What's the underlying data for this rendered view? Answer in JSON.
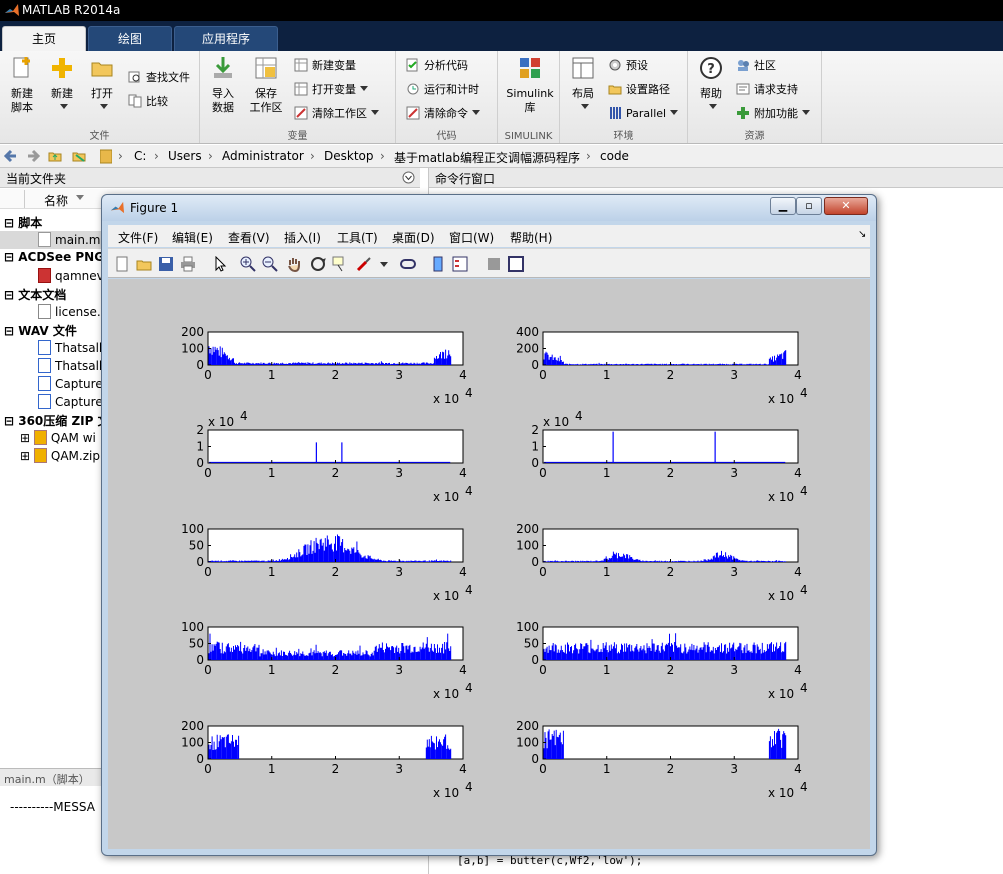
{
  "window": {
    "title": "MATLAB R2014a"
  },
  "tabs": [
    {
      "label": "主页",
      "active": true
    },
    {
      "label": "绘图",
      "active": false
    },
    {
      "label": "应用程序",
      "active": false
    }
  ],
  "ribbon": {
    "file": {
      "section_label": "文件",
      "new_script": "新建\n脚本",
      "new": "新建",
      "open": "打开",
      "find_files": "查找文件",
      "compare": "比较"
    },
    "variable": {
      "section_label": "变量",
      "import": "导入\n数据",
      "save_ws": "保存\n工作区",
      "new_var": "新建变量",
      "open_var": "打开变量",
      "clear_ws": "清除工作区"
    },
    "code": {
      "section_label": "代码",
      "analyze": "分析代码",
      "run_time": "运行和计时",
      "clear_cmd": "清除命令"
    },
    "simulink": {
      "section_label": "SIMULINK",
      "lib": "Simulink\n库"
    },
    "env": {
      "section_label": "环境",
      "layout": "布局",
      "prefs": "预设",
      "set_path": "设置路径",
      "parallel": "Parallel"
    },
    "resources": {
      "section_label": "资源",
      "help": "帮助",
      "community": "社区",
      "request_support": "请求支持",
      "addons": "附加功能"
    }
  },
  "address": {
    "crumbs": [
      "C:",
      "Users",
      "Administrator",
      "Desktop",
      "基于matlab编程正交调幅源码程序",
      "code"
    ]
  },
  "left_panel": {
    "title": "当前文件夹",
    "col_name": "名称",
    "groups": [
      {
        "label": "脚本",
        "items": [
          {
            "name": "main.m",
            "selected": true
          }
        ]
      },
      {
        "label": "ACDSee PNG",
        "items": [
          {
            "name": "qamnev"
          }
        ]
      },
      {
        "label": "文本文档",
        "items": [
          {
            "name": "license.t"
          }
        ]
      },
      {
        "label": "WAV 文件",
        "items": [
          {
            "name": "Thatsall"
          },
          {
            "name": "Thatsall"
          },
          {
            "name": "Capture"
          },
          {
            "name": "Capture"
          }
        ]
      },
      {
        "label": "360压缩 ZIP 文",
        "items": [
          {
            "name": "QAM wi"
          },
          {
            "name": "QAM.zip"
          }
        ]
      }
    ],
    "details_label": "main.m（脚本）",
    "details_text": "----------MESSA"
  },
  "cmd_window": {
    "title": "命令行窗口",
    "code_line": "[a,b] = butter(c,Wf2,'low');"
  },
  "figure": {
    "title": "Figure 1",
    "menu": [
      "文件(F)",
      "编辑(E)",
      "查看(V)",
      "插入(I)",
      "工具(T)",
      "桌面(D)",
      "窗口(W)",
      "帮助(H)"
    ],
    "exp_label": "x 10",
    "exp_pow": "4",
    "bar_color": "#0000ff"
  },
  "chart_data": [
    {
      "type": "bar",
      "position": "row1-left",
      "xlim": [
        0,
        40000
      ],
      "ylim": [
        0,
        200
      ],
      "yticks": [
        "0",
        "100",
        "200"
      ],
      "xticks": [
        "0",
        "1",
        "2",
        "3",
        "4"
      ],
      "x_multiplier": "x 10^4",
      "envelope": "high at both ends, near zero in middle",
      "peak": 150
    },
    {
      "type": "bar",
      "position": "row1-right",
      "xlim": [
        0,
        40000
      ],
      "ylim": [
        0,
        400
      ],
      "yticks": [
        "0",
        "200",
        "400"
      ],
      "xticks": [
        "0",
        "1",
        "2",
        "3",
        "4"
      ],
      "x_multiplier": "x 10^4",
      "envelope": "high at both ends, low in middle",
      "peak": 300
    },
    {
      "type": "bar",
      "position": "row2-left",
      "xlim": [
        0,
        40000
      ],
      "ylim": [
        0,
        20000
      ],
      "yticks": [
        "0",
        "1",
        "2"
      ],
      "y_multiplier": "x 10^4",
      "xticks": [
        "0",
        "1",
        "2",
        "3",
        "4"
      ],
      "x_multiplier": "x 10^4",
      "spikes": [
        {
          "x": 17000,
          "y": 12500
        },
        {
          "x": 21000,
          "y": 12500
        }
      ]
    },
    {
      "type": "bar",
      "position": "row2-right",
      "xlim": [
        0,
        40000
      ],
      "ylim": [
        0,
        20000
      ],
      "yticks": [
        "0",
        "1",
        "2"
      ],
      "y_multiplier": "x 10^4",
      "xticks": [
        "0",
        "1",
        "2",
        "3",
        "4"
      ],
      "x_multiplier": "x 10^4",
      "spikes": [
        {
          "x": 11000,
          "y": 19000
        },
        {
          "x": 27000,
          "y": 19000
        }
      ]
    },
    {
      "type": "bar",
      "position": "row3-left",
      "xlim": [
        0,
        40000
      ],
      "ylim": [
        0,
        100
      ],
      "yticks": [
        "0",
        "50",
        "100"
      ],
      "xticks": [
        "0",
        "1",
        "2",
        "3",
        "4"
      ],
      "x_multiplier": "x 10^4",
      "envelope": "low at edges, peak near center",
      "peak": 95
    },
    {
      "type": "bar",
      "position": "row3-right",
      "xlim": [
        0,
        40000
      ],
      "ylim": [
        0,
        200
      ],
      "yticks": [
        "0",
        "100",
        "200"
      ],
      "xticks": [
        "0",
        "1",
        "2",
        "3",
        "4"
      ],
      "x_multiplier": "x 10^4",
      "envelope": "two humps near 1.1 and 2.7",
      "peak": 70
    },
    {
      "type": "bar",
      "position": "row4-left",
      "xlim": [
        0,
        40000
      ],
      "ylim": [
        0,
        100
      ],
      "yticks": [
        "0",
        "50",
        "100"
      ],
      "xticks": [
        "0",
        "1",
        "2",
        "3",
        "4"
      ],
      "x_multiplier": "x 10^4",
      "envelope": "moderate, dip in middle",
      "peak": 80
    },
    {
      "type": "bar",
      "position": "row4-right",
      "xlim": [
        0,
        40000
      ],
      "ylim": [
        0,
        100
      ],
      "yticks": [
        "0",
        "50",
        "100"
      ],
      "xticks": [
        "0",
        "1",
        "2",
        "3",
        "4"
      ],
      "x_multiplier": "x 10^4",
      "envelope": "flat noisy throughout",
      "peak": 100
    },
    {
      "type": "bar",
      "position": "row5-left",
      "xlim": [
        0,
        40000
      ],
      "ylim": [
        0,
        200
      ],
      "yticks": [
        "0",
        "100",
        "200"
      ],
      "xticks": [
        "0",
        "1",
        "2",
        "3",
        "4"
      ],
      "x_multiplier": "x 10^4",
      "envelope": "energy only at both ends",
      "peak": 150
    },
    {
      "type": "bar",
      "position": "row5-right",
      "xlim": [
        0,
        40000
      ],
      "ylim": [
        0,
        200
      ],
      "yticks": [
        "0",
        "100",
        "200"
      ],
      "xticks": [
        "0",
        "1",
        "2",
        "3",
        "4"
      ],
      "x_multiplier": "x 10^4",
      "envelope": "energy only at both ends",
      "peak": 190
    }
  ]
}
